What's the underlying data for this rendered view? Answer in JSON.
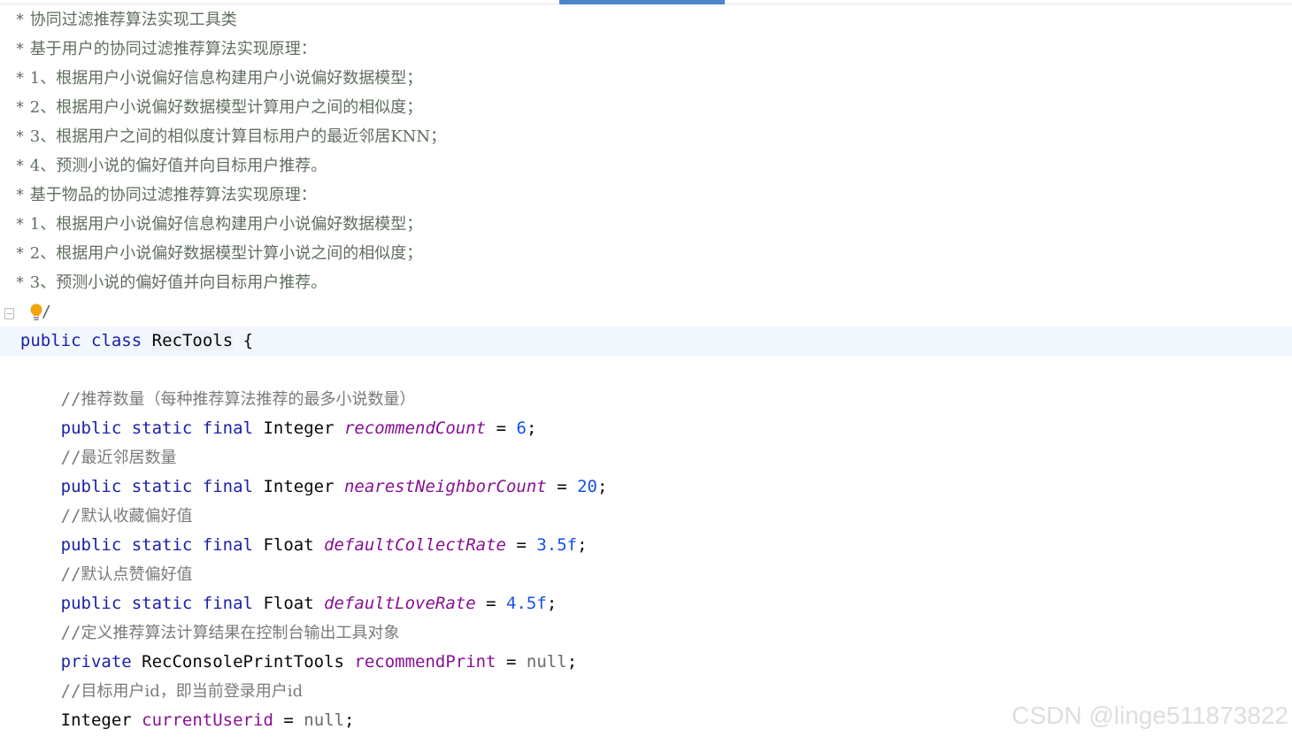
{
  "doc_comment": [
    {
      "star": "*",
      "text": "协同过滤推荐算法实现工具类"
    },
    {
      "star": "*",
      "text": "基于用户的协同过滤推荐算法实现原理："
    },
    {
      "star": "*",
      "text": "1、根据用户小说偏好信息构建用户小说偏好数据模型；"
    },
    {
      "star": "*",
      "text": "2、根据用户小说偏好数据模型计算用户之间的相似度；"
    },
    {
      "star": "*",
      "text": "3、根据用户之间的相似度计算目标用户的最近邻居KNN；"
    },
    {
      "star": "*",
      "text": "4、预测小说的偏好值并向目标用户推荐。"
    },
    {
      "star": "*",
      "text": "基于物品的协同过滤推荐算法实现原理："
    },
    {
      "star": "*",
      "text": "1、根据用户小说偏好信息构建用户小说偏好数据模型；"
    },
    {
      "star": "*",
      "text": "2、根据用户小说偏好数据模型计算小说之间的相似度；"
    },
    {
      "star": "*",
      "text": "3、预测小说的偏好值并向目标用户推荐。"
    }
  ],
  "doc_end": "/",
  "class_decl": {
    "kw_public": "public",
    "kw_class": "class",
    "name": "RecTools",
    "brace": "{"
  },
  "members": [
    {
      "comment_slashes": "//",
      "comment_text": "推荐数量（每种推荐算法推荐的最多小说数量）",
      "modifiers": "public static final",
      "type": "Integer",
      "name": "recommendCount",
      "eq": "=",
      "value": "6",
      "semi": ";"
    },
    {
      "comment_slashes": "//",
      "comment_text": "最近邻居数量",
      "modifiers": "public static final",
      "type": "Integer",
      "name": "nearestNeighborCount",
      "eq": "=",
      "value": "20",
      "semi": ";"
    },
    {
      "comment_slashes": "//",
      "comment_text": "默认收藏偏好值",
      "modifiers": "public static final",
      "type": "Float",
      "name": "defaultCollectRate",
      "eq": "=",
      "value": "3.5f",
      "semi": ";"
    },
    {
      "comment_slashes": "//",
      "comment_text": "默认点赞偏好值",
      "modifiers": "public static final",
      "type": "Float",
      "name": "defaultLoveRate",
      "eq": "=",
      "value": "4.5f",
      "semi": ";"
    }
  ],
  "instance_members": [
    {
      "comment_slashes": "//",
      "comment_text": "定义推荐算法计算结果在控制台输出工具对象",
      "modifiers": "private",
      "type": "RecConsolePrintTools",
      "name": "recommendPrint",
      "eq": "=",
      "value": "null",
      "semi": ";"
    },
    {
      "comment_slashes": "//",
      "comment_text": "目标用户id，即当前登录用户id",
      "modifiers": "",
      "type": "Integer",
      "name": "currentUserid",
      "eq": "=",
      "value": "null",
      "semi": ";"
    }
  ],
  "watermark": "CSDN @linge511873822",
  "colors": {
    "keyword": "#1b21a8",
    "field": "#871094",
    "number": "#1750eb",
    "comment": "#7a7a7a",
    "line_highlight": "#f2f6fd"
  },
  "icons": {
    "gutter": "fold-marker-icon",
    "intention": "lightbulb-icon"
  }
}
